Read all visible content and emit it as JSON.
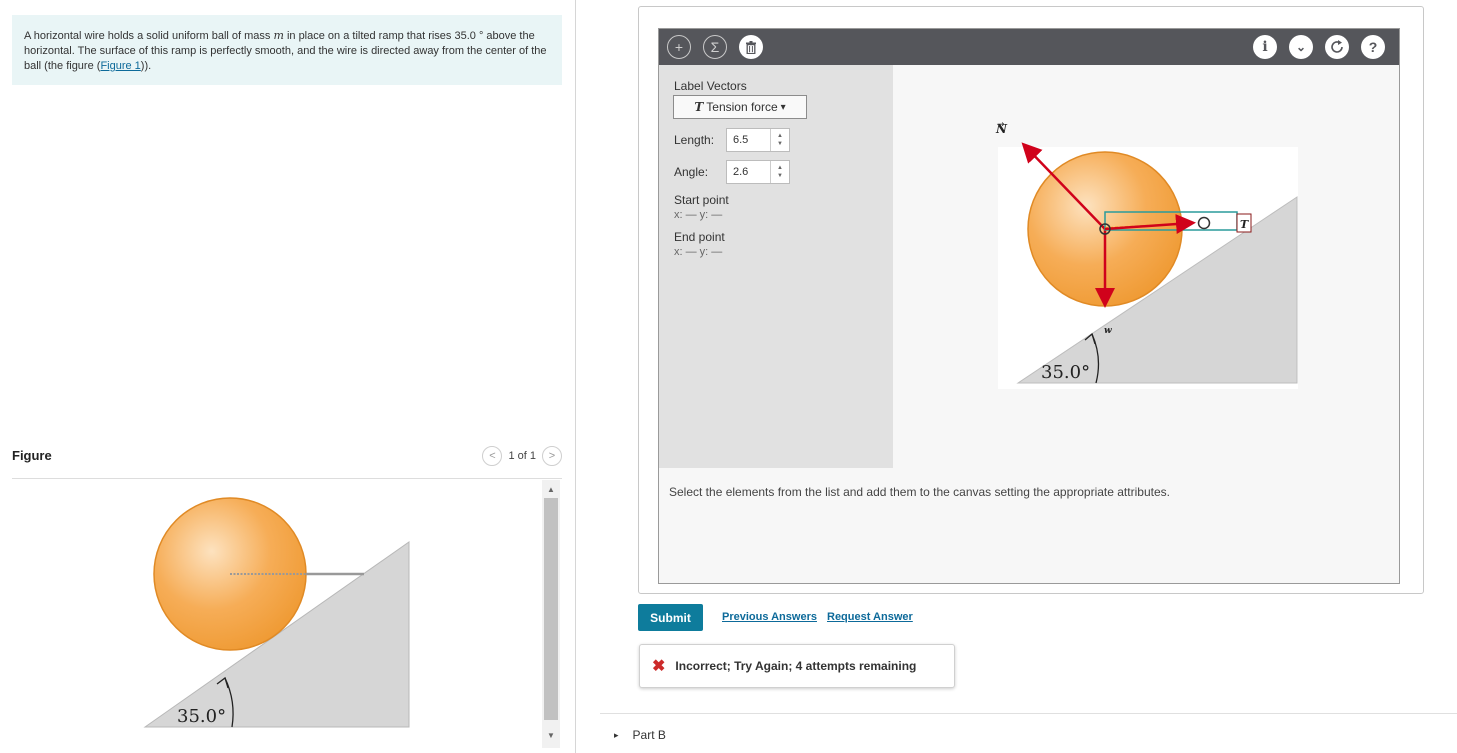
{
  "problem": {
    "text_before_var": "A horizontal wire holds a solid uniform ball of mass ",
    "mass_var": "m",
    "text_after_var": " in place on a tilted ramp that rises 35.0 ° above the horizontal. The surface of this ramp is perfectly smooth, and the wire is directed away from the center of the ball (the figure (",
    "figure_link": "Figure 1",
    "text_end": "))."
  },
  "figure": {
    "title": "Figure",
    "pager_text": "1 of 1",
    "prev_glyph": "<",
    "next_glyph": ">",
    "angle_label": "35.0°"
  },
  "tool": {
    "label_vectors": "Label Vectors",
    "selected_vector_symbol": "T",
    "selected_vector_label": "Tension force",
    "dropdown_caret": "▾",
    "length_label": "Length:",
    "length_value": "6.5",
    "angle_label": "Angle:",
    "angle_value": "2.6",
    "start_point_label": "Start point",
    "start_point_coords": "x: — y: —",
    "end_point_label": "End point",
    "end_point_coords": "x: — y: —",
    "instruction": "Select the elements from the list and add them to the canvas setting the appropriate attributes.",
    "toolbar_glyphs": {
      "add": "+",
      "sum": "Σ",
      "info": "i",
      "menu": "⌄",
      "help": "?"
    },
    "vector_labels": {
      "normal": "N",
      "tension": "T",
      "weight": "w"
    },
    "angle_label_canvas": "35.0°"
  },
  "controls": {
    "submit": "Submit",
    "previous_answers": "Previous Answers",
    "request_answer": "Request Answer"
  },
  "feedback": {
    "icon": "✖",
    "text": "Incorrect; Try Again; 4 attempts remaining"
  },
  "part_b": {
    "label": "Part B",
    "arrow": "▸"
  },
  "colors": {
    "toolbar_bg": "#55565b",
    "submit_bg": "#0e7c9c",
    "link": "#0d6a9a",
    "problem_bg": "#e9f5f6",
    "vector_red": "#d0021b",
    "ball_orange": "#f5a845",
    "ramp_gray": "#d6d6d6"
  }
}
